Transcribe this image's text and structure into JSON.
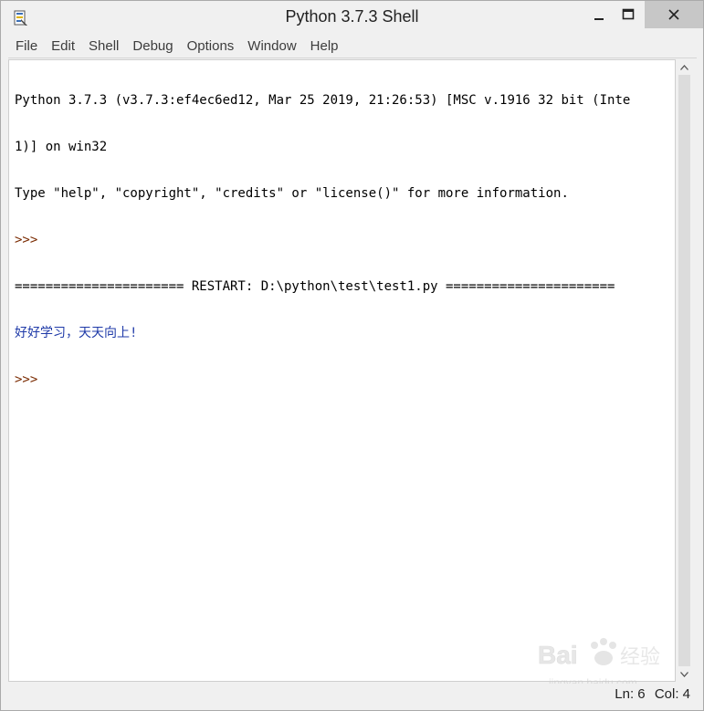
{
  "window": {
    "title": "Python 3.7.3 Shell",
    "app_icon": "python-idle-icon"
  },
  "menu": {
    "items": [
      {
        "label": "File"
      },
      {
        "label": "Edit"
      },
      {
        "label": "Shell"
      },
      {
        "label": "Debug"
      },
      {
        "label": "Options"
      },
      {
        "label": "Window"
      },
      {
        "label": "Help"
      }
    ]
  },
  "shell": {
    "lines": [
      "Python 3.7.3 (v3.7.3:ef4ec6ed12, Mar 25 2019, 21:26:53) [MSC v.1916 32 bit (Inte",
      "1)] on win32",
      "Type \"help\", \"copyright\", \"credits\" or \"license()\" for more information.",
      ">>>",
      "====================== RESTART: D:\\python\\test\\test1.py ======================",
      "好好学习，天天向上!",
      ">>>"
    ]
  },
  "status": {
    "line": "Ln: 6",
    "col": "Col: 4"
  },
  "watermark": {
    "text": "Bai 经验",
    "subtext": "jingyan.baidu.com"
  },
  "colors": {
    "output_text": "#1f3aa8",
    "prompt": "#7a2a00",
    "close_button_bg": "#c7c7c7"
  }
}
